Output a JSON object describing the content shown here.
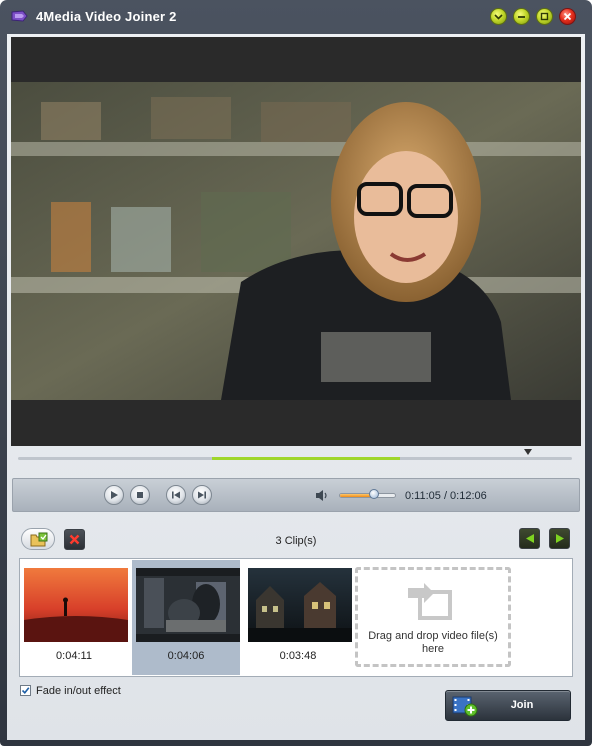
{
  "window": {
    "title": "4Media Video Joiner 2",
    "controls": [
      "minimize-to-tray",
      "minimize",
      "maximize",
      "close"
    ]
  },
  "player": {
    "time_current": "0:11:05",
    "time_total": "0:12:06",
    "time_display": "0:11:05 / 0:12:06",
    "volume_level": 0.62,
    "playhead_fraction": 0.916,
    "clip_segment_fraction": [
      0.35,
      0.69
    ]
  },
  "clips": {
    "count_label": "3 Clip(s)",
    "items": [
      {
        "duration": "0:04:11",
        "selected": false,
        "scene": "sunset-silhouette"
      },
      {
        "duration": "0:04:06",
        "selected": true,
        "scene": "dark-room"
      },
      {
        "duration": "0:03:48",
        "selected": false,
        "scene": "house-at-night"
      }
    ],
    "drop_hint": "Drag and drop video file(s) here"
  },
  "options": {
    "fade_label": "Fade in/out effect",
    "fade_checked": true
  },
  "join": {
    "label": "Join"
  },
  "colors": {
    "accent_green": "#9fd62a",
    "title_bar": "#3a414c",
    "window_button": "#c3d82b",
    "close_button": "#e6301e"
  },
  "icons": [
    "app-icon",
    "add-file-icon",
    "remove-icon",
    "play-icon",
    "stop-icon",
    "previous-icon",
    "next-icon",
    "volume-icon",
    "move-left-icon",
    "move-right-icon",
    "drop-arrow-icon",
    "join-film-icon"
  ]
}
